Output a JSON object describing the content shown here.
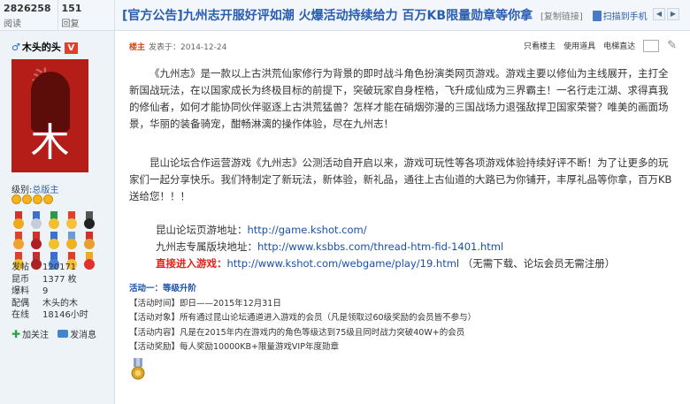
{
  "header": {
    "views": "2826258",
    "views_label": "阅读",
    "replies": "151",
    "replies_label": "回复",
    "title": "[官方公告]九州志开服好评如潮 火爆活动持续给力 百万KB限量勋章等你拿",
    "copy_link": "[复制链接]",
    "phone_label": "扫描到手机"
  },
  "user": {
    "name": "木头的头",
    "v": "V",
    "avatar_char": "木",
    "level_label": "级别:",
    "level": "总版主",
    "stats": [
      {
        "k": "发帖",
        "v": "120171"
      },
      {
        "k": "昆币",
        "v": "1377 枚"
      },
      {
        "k": "爆料",
        "v": "9"
      },
      {
        "k": "配偶",
        "v": "木头的木"
      },
      {
        "k": "在线",
        "v": "18146小时"
      }
    ],
    "follow_label": "加关注",
    "msg_label": "发消息"
  },
  "post": {
    "op_label": "楼主",
    "date": "发表于：2014-12-24",
    "tools": [
      "只看楼主",
      "使用道具",
      "电梯直达"
    ],
    "para1": "《九州志》是一款以上古洪荒仙家修行为背景的即时战斗角色扮演类网页游戏。游戏主要以修仙为主线展开，主打全新国战玩法，在以国家成长为终极目标的前提下，突破玩家自身桎梏，飞升成仙成为三界霸主！一名行走江湖、求得真我的修仙者，如何才能协同伙伴驱逐上古洪荒猛兽？怎样才能在硝烟弥漫的三国战场力退强敌捍卫国家荣誉？唯美的画面场景，华丽的装备骑宠，酣畅淋漓的操作体验，尽在九州志！",
    "para2": "昆山论坛合作运营游戏《九州志》公测活动自开启以来，游戏可玩性等各项游戏体验持续好评不断！为了让更多的玩家们一起分享快乐。我们特制定了新玩法，新体验，新礼品，通往上古仙道的大路已为你铺开，丰厚礼品等你拿，百万KB送给您！！！",
    "site_label": "昆山论坛页游地址：",
    "site_url": "http://game.kshot.com/",
    "board_label": "九州志专属版块地址：",
    "board_url": "http://www.ksbbs.com/thread-htm-fid-1401.html",
    "direct_label": "直接进入游戏：",
    "direct_url": "http://www.kshot.com/webgame/play/19.html",
    "direct_note": "（无需下载、论坛会员无需注册）"
  },
  "activity": {
    "title": "活动一：等级升阶",
    "lines": [
      "【活动时间】即日——2015年12月31日",
      "【活动对象】所有通过昆山论坛通道进入游戏的会员（凡是领取过60级奖励的会员皆不参与）",
      "【活动内容】凡是在2015年内在游戏内的角色等级达到75级且同时战力突破40W+的会员",
      "【活动奖励】每人奖励10000KB+限量游戏VIP年度勋章"
    ]
  },
  "colors": {
    "accent": "#2a5db0",
    "link": "#1b4fa8",
    "alert": "#e0241c",
    "sidebar_bg": "#eef3f8"
  }
}
